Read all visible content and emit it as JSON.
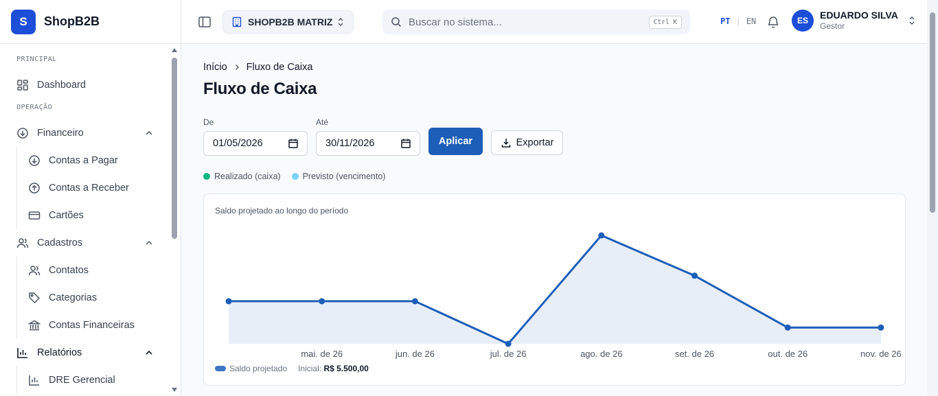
{
  "brand": {
    "logo_letter": "S",
    "name": "ShopB2B"
  },
  "sidebar": {
    "sections": [
      {
        "label": "PRINCIPAL"
      },
      {
        "label": "OPERAÇÃO"
      }
    ],
    "items": {
      "dashboard": "Dashboard",
      "financeiro": "Financeiro",
      "contas_pagar": "Contas a Pagar",
      "contas_receber": "Contas a Receber",
      "cartoes": "Cartões",
      "cadastros": "Cadastros",
      "contatos": "Contatos",
      "categorias": "Categorias",
      "contas_financeiras": "Contas Financeiras",
      "relatorios": "Relatórios",
      "dre": "DRE Gerencial"
    }
  },
  "header": {
    "company": "SHOPB2B MATRIZ",
    "search_placeholder": "Buscar no sistema...",
    "search_shortcut": "Ctrl K",
    "lang_pt": "PT",
    "lang_sep": "|",
    "lang_en": "EN",
    "user": {
      "initials": "ES",
      "name": "EDUARDO SILVA",
      "role": "Gestor"
    }
  },
  "page": {
    "breadcrumb": [
      "Início",
      "Fluxo de Caixa"
    ],
    "title": "Fluxo de Caixa",
    "filters": {
      "from_label": "De",
      "from_value": "01/05/2026",
      "to_label": "Até",
      "to_value": "30/11/2026",
      "apply": "Aplicar",
      "export": "Exportar"
    },
    "legend": [
      {
        "label": "Realizado (caixa)",
        "color": "#10b981"
      },
      {
        "label": "Previsto (vencimento)",
        "color": "#7dd3fc"
      }
    ],
    "card_title": "Saldo projetado ao longo do período",
    "footer": {
      "series_label": "Saldo projetado",
      "initial_label": "Inicial:",
      "initial_value": "R$ 5.500,00"
    }
  },
  "colors": {
    "accent": "#1d5eb8",
    "area_fill": "#e8eef8"
  },
  "chart_data": {
    "type": "area",
    "categories": [
      "",
      "mai. de 26",
      "jun. de 26",
      "jul. de 26",
      "ago. de 26",
      "set. de 26",
      "out. de 26",
      "nov. de 26"
    ],
    "series": [
      {
        "name": "Saldo projetado",
        "values": [
          5500,
          5500,
          5500,
          0,
          14000,
          8800,
          2100,
          2100
        ]
      }
    ],
    "title": "Saldo projetado ao longo do período",
    "ylim": [
      0,
      14000
    ],
    "grid": false,
    "legend": "bottom-left"
  }
}
